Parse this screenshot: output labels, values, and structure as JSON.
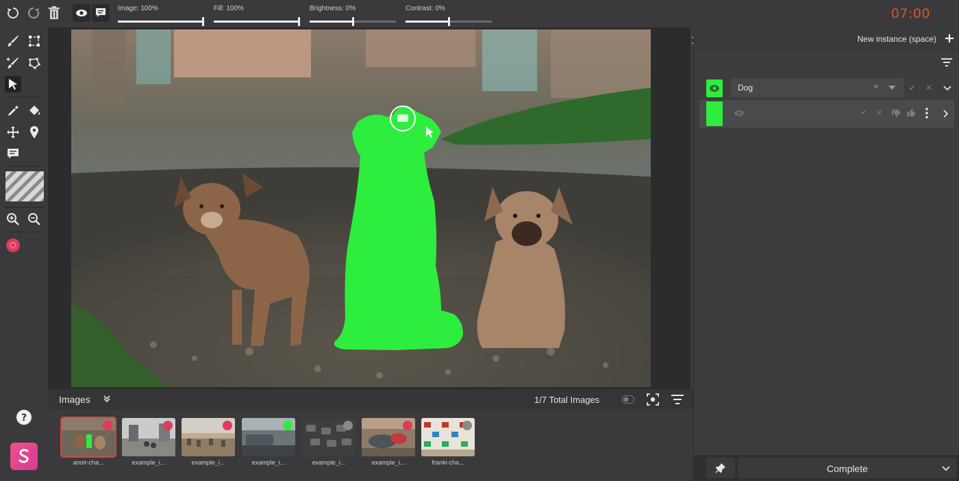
{
  "toolbar_top": {
    "icons": [
      "undo-icon",
      "redo-icon",
      "trash-icon",
      "eye-icon",
      "comment-icon"
    ],
    "sliders": [
      {
        "label": "Image: 100%",
        "value": 100
      },
      {
        "label": "Fill: 100%",
        "value": 100
      },
      {
        "label": "Brightness: 0%",
        "value": 50
      },
      {
        "label": "Contrast: 0%",
        "value": 50
      }
    ],
    "timer": "07:00"
  },
  "tools": [
    "brush-icon",
    "polygon-icon",
    "brush-plus-icon",
    "polygon-plus-icon",
    "pointer-icon",
    "eyedropper-icon",
    "bucket-icon",
    "move-icon",
    "pin-icon",
    "comment-icon",
    "pattern-icon",
    "zoom-in-icon",
    "zoom-out-icon",
    "record-icon"
  ],
  "colors": {
    "accent_green": "#2dee3e",
    "accent_red": "#e0403c",
    "timer": "#e2502d",
    "logo": "#e8427c"
  },
  "images_panel": {
    "title": "Images",
    "count": "1/7 Total Images",
    "thumbnails": [
      {
        "caption": "anoir-cha...",
        "status": "rejected",
        "active": true
      },
      {
        "caption": "example_i...",
        "status": "rejected",
        "active": false
      },
      {
        "caption": "example_i...",
        "status": "rejected",
        "active": false
      },
      {
        "caption": "example_i...",
        "status": "accepted",
        "active": false
      },
      {
        "caption": "example_i...",
        "status": "pending",
        "active": false
      },
      {
        "caption": "example_i...",
        "status": "rejected",
        "active": false
      },
      {
        "caption": "franki-cha...",
        "status": "pending",
        "active": false
      }
    ]
  },
  "instances": {
    "new_instance_label": "New instance (space)",
    "class_label": "Dog",
    "complete_label": "Complete"
  }
}
